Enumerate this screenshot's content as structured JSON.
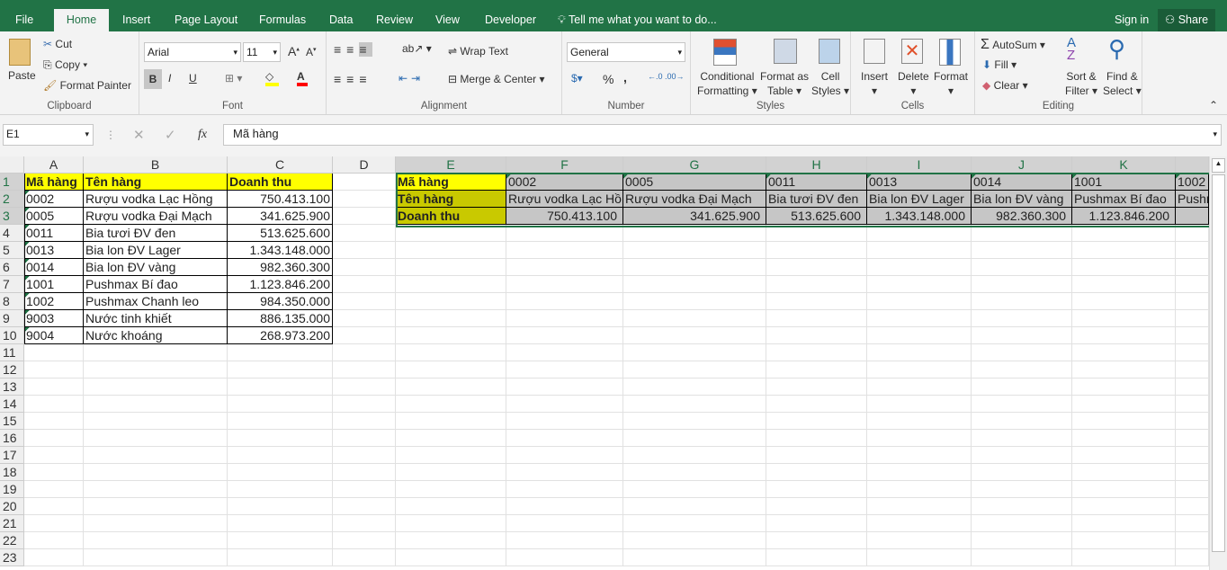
{
  "tabs": [
    "File",
    "Home",
    "Insert",
    "Page Layout",
    "Formulas",
    "Data",
    "Review",
    "View",
    "Developer"
  ],
  "tell_me": "Tell me what you want to do...",
  "sign_in": "Sign in",
  "share": "Share",
  "clipboard": {
    "paste": "Paste",
    "cut": "Cut",
    "copy": "Copy",
    "format_painter": "Format Painter",
    "label": "Clipboard"
  },
  "font": {
    "name": "Arial",
    "size": "11",
    "bold": "B",
    "italic": "I",
    "underline": "U",
    "label": "Font"
  },
  "alignment": {
    "wrap": "Wrap Text",
    "merge": "Merge & Center",
    "label": "Alignment"
  },
  "number": {
    "format": "General",
    "percent": "%",
    "comma": ",",
    "label": "Number"
  },
  "styles": {
    "conditional": "Conditional",
    "conditional2": "Formatting",
    "format_as": "Format as",
    "format_as2": "Table",
    "cell": "Cell",
    "cell2": "Styles",
    "label": "Styles"
  },
  "cells": {
    "insert": "Insert",
    "delete": "Delete",
    "format": "Format",
    "label": "Cells"
  },
  "editing": {
    "autosum": "AutoSum",
    "fill": "Fill",
    "clear": "Clear",
    "sort": "Sort &",
    "sort2": "Filter",
    "find": "Find &",
    "find2": "Select",
    "label": "Editing"
  },
  "formula_bar": {
    "name_box": "E1",
    "fx": "fx",
    "content": "Mã hàng"
  },
  "columns": [
    "A",
    "B",
    "C",
    "D",
    "E",
    "F",
    "G",
    "H",
    "I",
    "J",
    "K",
    ""
  ],
  "rows": 23,
  "table": {
    "header": [
      "Mã hàng",
      "Tên hàng",
      "Doanh thu"
    ],
    "rows": [
      [
        "0002",
        "Rượu vodka Lạc Hồng",
        "750.413.100"
      ],
      [
        "0005",
        "Rượu vodka Đại Mạch",
        "341.625.900"
      ],
      [
        "0011",
        "Bia tươi ĐV đen",
        "513.625.600"
      ],
      [
        "0013",
        "Bia lon ĐV Lager",
        "1.343.148.000"
      ],
      [
        "0014",
        "Bia lon ĐV vàng",
        "982.360.300"
      ],
      [
        "1001",
        "Pushmax Bí đao",
        "1.123.846.200"
      ],
      [
        "1002",
        "Pushmax Chanh leo",
        "984.350.000"
      ],
      [
        "9003",
        "Nước tinh khiết",
        "886.135.000"
      ],
      [
        "9004",
        "Nước khoáng",
        "268.973.200"
      ]
    ]
  },
  "transposed": {
    "labels": [
      "Mã hàng",
      "Tên hàng",
      "Doanh thu"
    ],
    "codes": [
      "0002",
      "0005",
      "0011",
      "0013",
      "0014",
      "1001",
      "1002"
    ],
    "names": [
      "Rượu vodka Lạc Hồng",
      "Rượu vodka Đại Mạch",
      "Bia tươi ĐV đen",
      "Bia lon ĐV Lager",
      "Bia lon ĐV vàng",
      "Pushmax Bí đao",
      "Pushmax Chanh leo"
    ],
    "revenues": [
      "750.413.100",
      "341.625.900",
      "513.625.600",
      "1.343.148.000",
      "982.360.300",
      "1.123.846.200",
      ""
    ]
  },
  "colors": {
    "green": "#217346",
    "yellow": "#ffff00",
    "olive": "#c9c900",
    "selected": "#c6c6c6"
  }
}
